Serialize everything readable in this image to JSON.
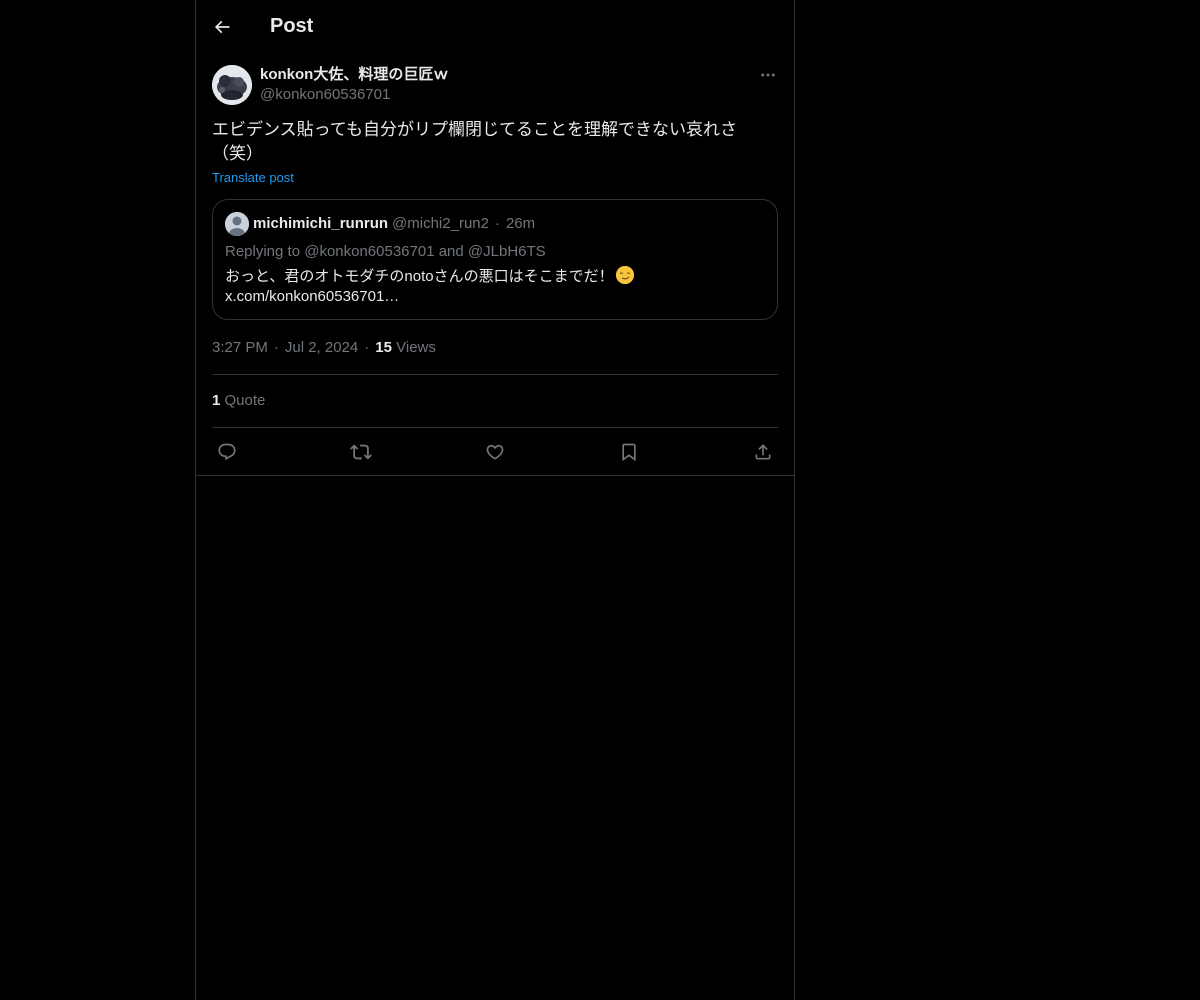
{
  "header": {
    "title": "Post"
  },
  "post": {
    "display_name": "konkon大佐、料理の巨匠ｗ",
    "handle": "@konkon60536701",
    "text": "エビデンス貼っても自分がリプ欄閉じてることを理解できない哀れさ\n（笑）",
    "translate_label": "Translate post",
    "time": "3:27 PM",
    "date": "Jul 2, 2024",
    "views_count": "15",
    "views_label": "Views",
    "quotes_count": "1",
    "quotes_label": "Quote"
  },
  "quote": {
    "display_name": "michimichi_runrun",
    "handle": "@michi2_run2",
    "dot": "·",
    "time": "26m",
    "replying": "Replying to @konkon60536701 and @JLbH6TS",
    "body": "おっと、君のオトモダチのnotoさんの悪口はそこまでだ！",
    "link": "x.com/konkon60536701…"
  },
  "meta_sep": "·",
  "icons": {
    "back": "arrow-left-icon",
    "more": "more-horizontal-icon",
    "reply": "reply-icon",
    "repost": "repost-icon",
    "like": "heart-icon",
    "bookmark": "bookmark-icon",
    "share": "share-icon",
    "emoji": "smirk-emoji-icon"
  },
  "colors": {
    "background": "#000000",
    "text": "#e7e9ea",
    "muted": "#71767b",
    "accent": "#1d9bf0",
    "border": "#2f3336"
  }
}
